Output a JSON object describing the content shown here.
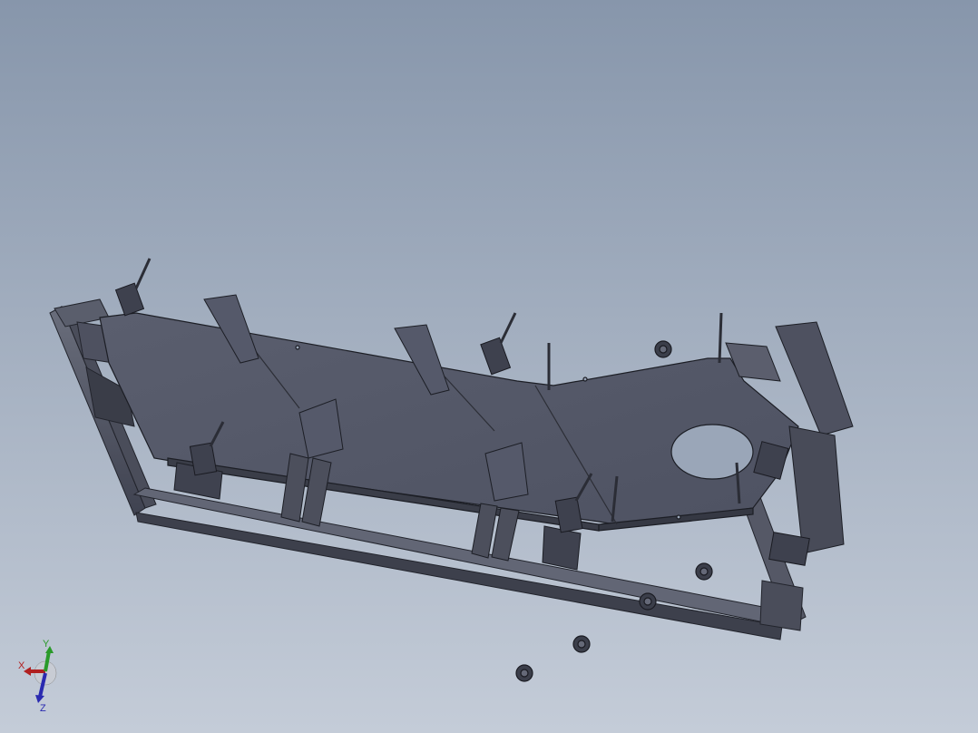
{
  "viewport": {
    "background_top": "#8796ab",
    "background_bottom": "#c4ccd8",
    "part_color": "#5c6070",
    "edge_color": "#22242c"
  },
  "triad": {
    "x_label": "X",
    "y_label": "Y",
    "z_label": "Z",
    "x_color": "#b02020",
    "y_color": "#2a9a2a",
    "z_color": "#2a2ab0"
  }
}
